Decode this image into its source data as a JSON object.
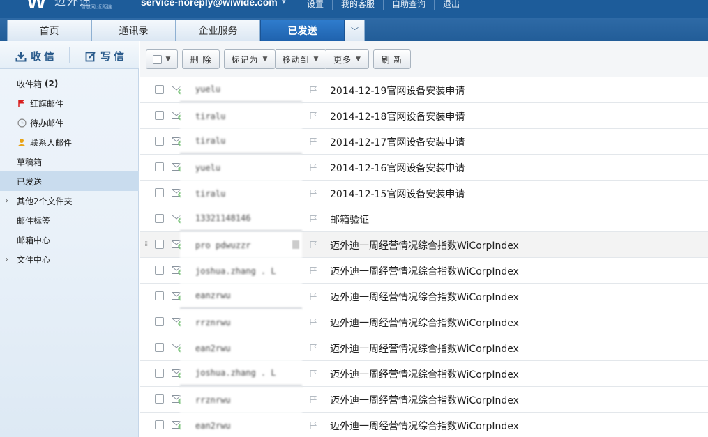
{
  "header": {
    "logo_brand": "迈外迪",
    "logo_slogan": "智慧网,近距链",
    "account": "service-noreply@wiwide.com",
    "links": [
      "设置",
      "我的客服",
      "自助查询",
      "退出"
    ]
  },
  "tabs": [
    {
      "label": "首页",
      "active": false
    },
    {
      "label": "通讯录",
      "active": false
    },
    {
      "label": "企业服务",
      "active": false
    },
    {
      "label": "已发送",
      "active": true
    }
  ],
  "sidebar": {
    "receive_label": "收信",
    "compose_label": "写信",
    "folders": [
      {
        "label": "收件箱",
        "count": "(2)",
        "icon": "",
        "expand": false
      },
      {
        "label": "红旗邮件",
        "count": "",
        "icon": "red-flag-icon",
        "expand": false
      },
      {
        "label": "待办邮件",
        "count": "",
        "icon": "clock-icon",
        "expand": false
      },
      {
        "label": "联系人邮件",
        "count": "",
        "icon": "contact-icon",
        "expand": false
      },
      {
        "label": "草稿箱",
        "count": "",
        "icon": "",
        "expand": false
      },
      {
        "label": "已发送",
        "count": "",
        "icon": "",
        "expand": false,
        "selected": true
      },
      {
        "label": "其他2个文件夹",
        "count": "",
        "icon": "",
        "expand": true
      },
      {
        "label": "邮件标签",
        "count": "",
        "icon": "",
        "expand": false
      },
      {
        "label": "邮箱中心",
        "count": "",
        "icon": "",
        "expand": false
      },
      {
        "label": "文件中心",
        "count": "",
        "icon": "",
        "expand": true
      }
    ]
  },
  "toolbar": {
    "delete": "删 除",
    "mark_as": "标记为",
    "move_to": "移动到",
    "more": "更多",
    "refresh": "刷 新"
  },
  "mails": [
    {
      "sender": "yuelu",
      "subject": "2014-12-19官网设备安装申请",
      "underline": true
    },
    {
      "sender": "tiralu",
      "subject": "2014-12-18官网设备安装申请",
      "underline": false
    },
    {
      "sender": "tiralu",
      "subject": "2014-12-17官网设备安装申请",
      "underline": true
    },
    {
      "sender": "yuelu",
      "subject": "2014-12-16官网设备安装申请",
      "underline": false
    },
    {
      "sender": "tiralu",
      "subject": "2014-12-15官网设备安装申请",
      "underline": false
    },
    {
      "sender": "13321148146",
      "subject": "邮箱验证",
      "underline": true
    },
    {
      "sender": "pro  pdwuzzr",
      "subject": "迈外迪一周经营情况综合指数WiCorpIndex",
      "underline": false,
      "highlight": true
    },
    {
      "sender": "joshua.zhang . L",
      "subject": "迈外迪一周经营情况综合指数WiCorpIndex",
      "underline": false
    },
    {
      "sender": "eanzrwu",
      "subject": "迈外迪一周经营情况综合指数WiCorpIndex",
      "underline": true
    },
    {
      "sender": "rrznrwu",
      "subject": "迈外迪一周经营情况综合指数WiCorpIndex",
      "underline": false
    },
    {
      "sender": "ean2rwu",
      "subject": "迈外迪一周经营情况综合指数WiCorpIndex",
      "underline": false
    },
    {
      "sender": "joshua.zhang . L",
      "subject": "迈外迪一周经营情况综合指数WiCorpIndex",
      "underline": true
    },
    {
      "sender": "rrznrwu",
      "subject": "迈外迪一周经营情况综合指数WiCorpIndex",
      "underline": false
    },
    {
      "sender": "ean2rwu",
      "subject": "迈外迪一周经营情况综合指数WiCorpIndex",
      "underline": false
    }
  ],
  "colors": {
    "nav_blue": "#2e6aa6",
    "active_tab": "#2f7ccd",
    "link_blue": "#2a5b8c",
    "red_flag": "#d81e1e",
    "contact_orange": "#e8a317",
    "mail_green": "#3aa63a"
  }
}
